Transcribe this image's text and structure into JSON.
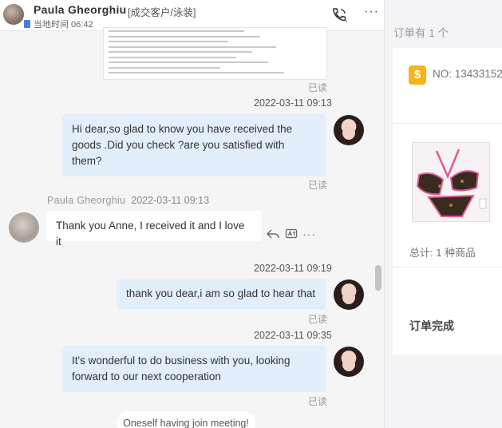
{
  "header": {
    "contact_name": "Paula Gheorghiu",
    "tag": "[成交客户/泳装]",
    "local_time_label": "当地时间 06:42",
    "phone_icon": "phone-call-icon",
    "more_icon": "more-dots-icon"
  },
  "messages": {
    "m0_status": "已读",
    "m1_time": "2022-03-11 09:13",
    "m1_text": "Hi dear,so glad to know you have received the goods .Did you check ?are you satisfied with them?",
    "m1_status": "已读",
    "m2_sender": "Paula Gheorghiu",
    "m2_time": "2022-03-11 09:13",
    "m2_text": "Thank you Anne, I received it and I love it",
    "m3_time": "2022-03-11 09:19",
    "m3_text": "thank you dear,i am so glad to hear that",
    "m3_status": "已读",
    "m4_time": "2022-03-11 09:35",
    "m4_text": "It's wonderful to do business with you, looking forward to our next cooperation",
    "m4_status": "已读",
    "system_text": "Oneself having join meeting!"
  },
  "sidebar": {
    "order_count_label": "订单有 1 个",
    "order_no": "NO: 13433152",
    "total_label": "总计: 1 种商品",
    "status_label": "订单完成"
  },
  "colors": {
    "bubble_mine": "#e3eefb",
    "bubble_other": "#ffffff",
    "chat_bg": "#f5f5f5",
    "badge": "#f3b51b"
  }
}
